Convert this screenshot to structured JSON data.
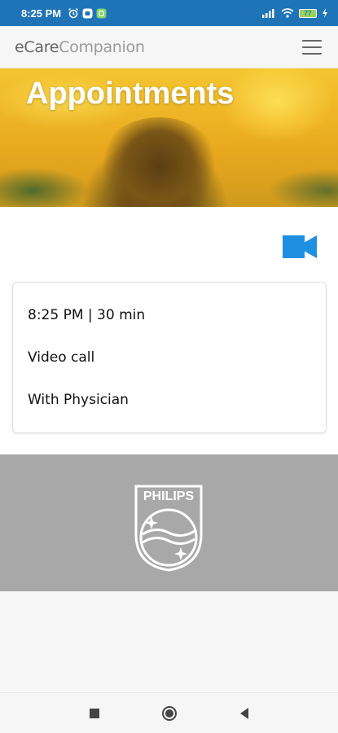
{
  "status_bar": {
    "time": "8:25 PM",
    "battery": "77"
  },
  "header": {
    "logo_part1": "eCare",
    "logo_part2": "Companion"
  },
  "hero": {
    "title": "Appointments"
  },
  "appointment": {
    "time_duration": "8:25 PM | 30 min",
    "type": "Video call",
    "with": "With Physician"
  },
  "footer": {
    "brand": "PHILIPS"
  },
  "colors": {
    "status_bar": "#1f74b8",
    "accent": "#1e8fe1",
    "footer_bg": "#a8a8a8"
  },
  "icons": [
    "alarm-icon",
    "notification-icon",
    "signal-icon",
    "wifi-icon",
    "battery-icon",
    "menu-icon",
    "video-camera-icon",
    "philips-shield-icon",
    "nav-recents-icon",
    "nav-home-icon",
    "nav-back-icon"
  ]
}
